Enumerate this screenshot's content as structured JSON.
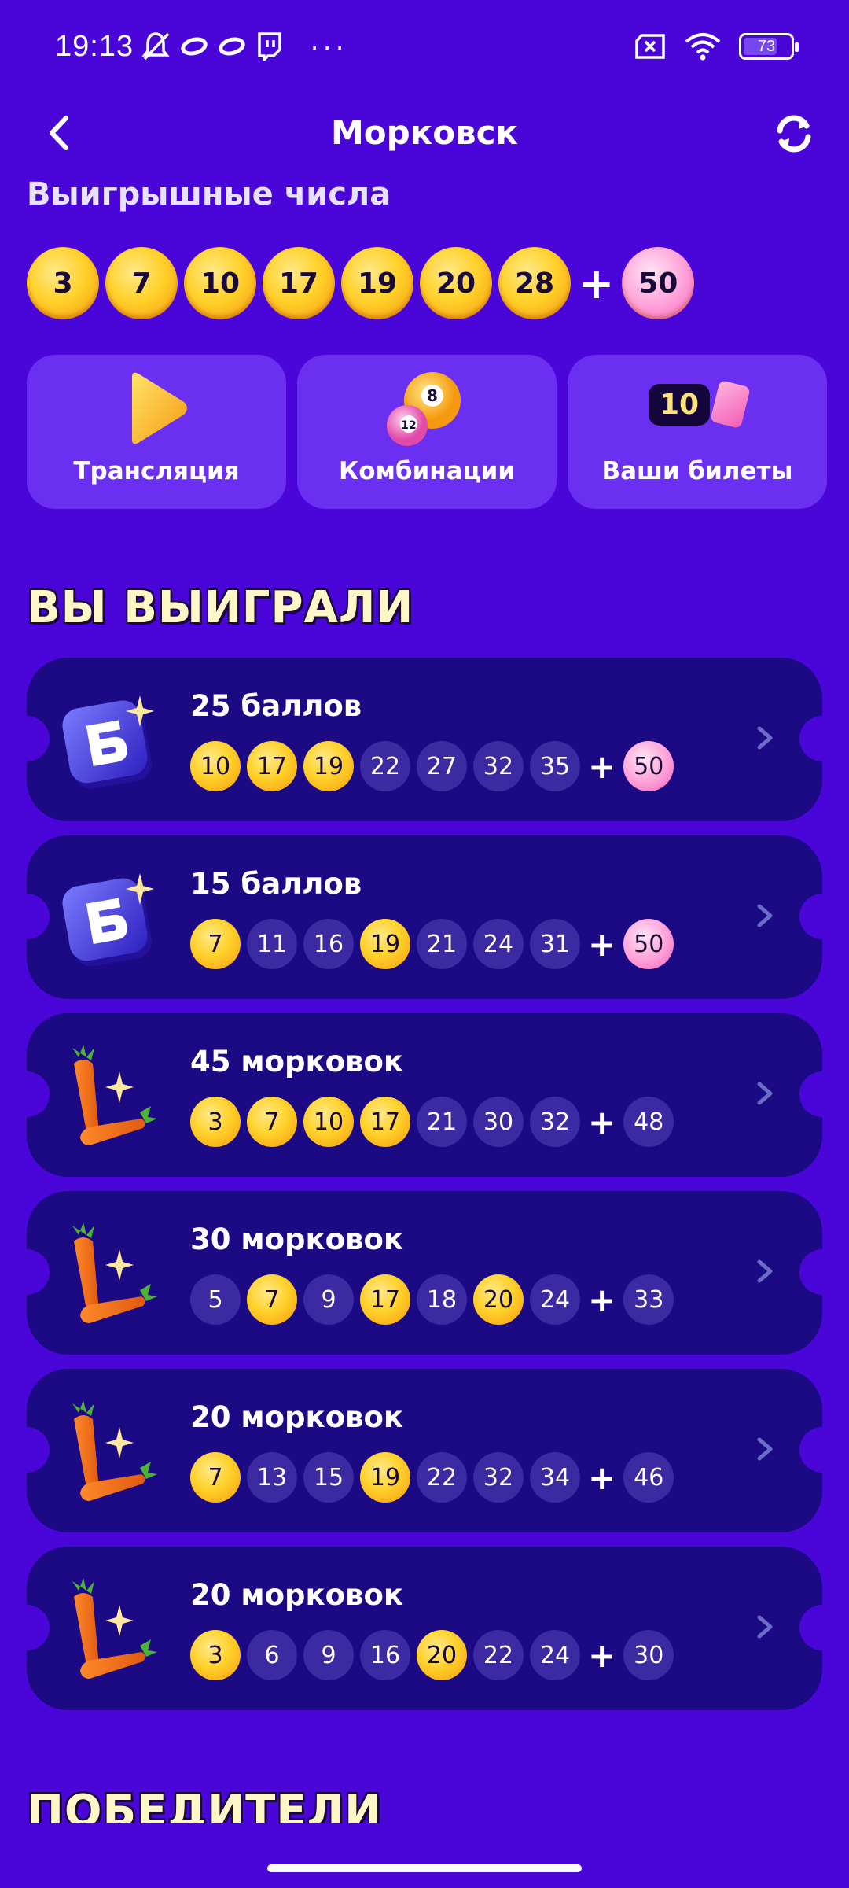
{
  "status_bar": {
    "time": "19:13",
    "battery": "73",
    "battery_level": 0.73,
    "more": "···"
  },
  "header": {
    "title": "Морковск"
  },
  "winning_numbers": {
    "label": "Выигрышные числа",
    "main": [
      "3",
      "7",
      "10",
      "17",
      "19",
      "20",
      "28"
    ],
    "plus": "+",
    "bonus": "50"
  },
  "actions": [
    {
      "label": "Трансляция",
      "icon": "play-icon"
    },
    {
      "label": "Комбинации",
      "icon": "lottery-balls-icon"
    },
    {
      "label": "Ваши билеты",
      "icon": "ticket-icon",
      "count": "10"
    }
  ],
  "won_title": "ВЫ ВЫИГРАЛИ",
  "prizes": [
    {
      "title": "25 баллов",
      "icon": "points-icon",
      "balls": [
        {
          "n": "10",
          "hit": true
        },
        {
          "n": "17",
          "hit": true
        },
        {
          "n": "19",
          "hit": true
        },
        {
          "n": "22",
          "hit": false
        },
        {
          "n": "27",
          "hit": false
        },
        {
          "n": "32",
          "hit": false
        },
        {
          "n": "35",
          "hit": false
        }
      ],
      "bonus": {
        "n": "50",
        "hit": true
      }
    },
    {
      "title": "15 баллов",
      "icon": "points-icon",
      "balls": [
        {
          "n": "7",
          "hit": true
        },
        {
          "n": "11",
          "hit": false
        },
        {
          "n": "16",
          "hit": false
        },
        {
          "n": "19",
          "hit": true
        },
        {
          "n": "21",
          "hit": false
        },
        {
          "n": "24",
          "hit": false
        },
        {
          "n": "31",
          "hit": false
        }
      ],
      "bonus": {
        "n": "50",
        "hit": true
      }
    },
    {
      "title": "45 морковок",
      "icon": "carrot-icon",
      "balls": [
        {
          "n": "3",
          "hit": true
        },
        {
          "n": "7",
          "hit": true
        },
        {
          "n": "10",
          "hit": true
        },
        {
          "n": "17",
          "hit": true
        },
        {
          "n": "21",
          "hit": false
        },
        {
          "n": "30",
          "hit": false
        },
        {
          "n": "32",
          "hit": false
        }
      ],
      "bonus": {
        "n": "48",
        "hit": false
      }
    },
    {
      "title": "30 морковок",
      "icon": "carrot-icon",
      "balls": [
        {
          "n": "5",
          "hit": false
        },
        {
          "n": "7",
          "hit": true
        },
        {
          "n": "9",
          "hit": false
        },
        {
          "n": "17",
          "hit": true
        },
        {
          "n": "18",
          "hit": false
        },
        {
          "n": "20",
          "hit": true
        },
        {
          "n": "24",
          "hit": false
        }
      ],
      "bonus": {
        "n": "33",
        "hit": false
      }
    },
    {
      "title": "20 морковок",
      "icon": "carrot-icon",
      "balls": [
        {
          "n": "7",
          "hit": true
        },
        {
          "n": "13",
          "hit": false
        },
        {
          "n": "15",
          "hit": false
        },
        {
          "n": "19",
          "hit": true
        },
        {
          "n": "22",
          "hit": false
        },
        {
          "n": "32",
          "hit": false
        },
        {
          "n": "34",
          "hit": false
        }
      ],
      "bonus": {
        "n": "46",
        "hit": false
      }
    },
    {
      "title": "20 морковок",
      "icon": "carrot-icon",
      "balls": [
        {
          "n": "3",
          "hit": true
        },
        {
          "n": "6",
          "hit": false
        },
        {
          "n": "9",
          "hit": false
        },
        {
          "n": "16",
          "hit": false
        },
        {
          "n": "20",
          "hit": true
        },
        {
          "n": "22",
          "hit": false
        },
        {
          "n": "24",
          "hit": false
        }
      ],
      "bonus": {
        "n": "30",
        "hit": false
      }
    }
  ],
  "winners_title": "ПОБЕДИТЕЛИ",
  "colors": {
    "background": "#4a06d9",
    "card": "#1b0a84",
    "action_card": "#6a2ff0",
    "gold": "#ffd12a",
    "pink": "#ff9fd8"
  }
}
